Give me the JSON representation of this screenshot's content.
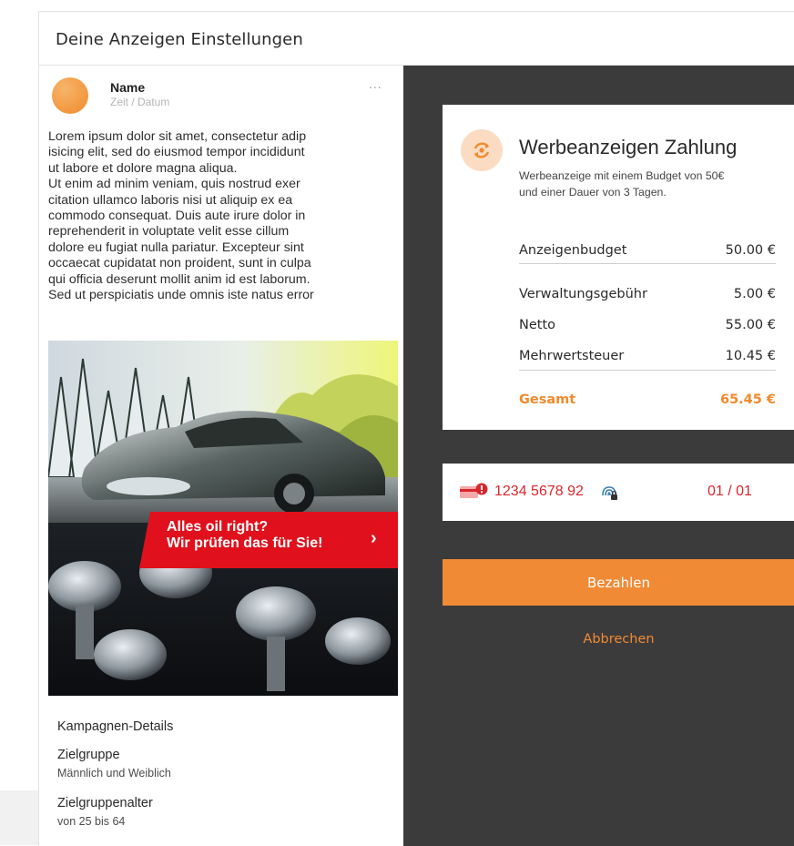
{
  "window": {
    "title": "Deine Anzeigen Einstellungen"
  },
  "post": {
    "name": "Name",
    "time": "Zeit / Datum",
    "more": "...",
    "body_lines": [
      "Lorem ipsum dolor sit amet, consectetur adip",
      "isicing elit, sed do eiusmod tempor incididunt",
      "ut labore et dolore magna aliqua.",
      "Ut enim ad minim veniam, quis nostrud exer",
      "citation ullamco laboris nisi ut aliquip ex ea",
      "commodo consequat. Duis aute irure dolor in",
      "reprehenderit in voluptate velit esse cillum",
      "dolore eu fugiat nulla pariatur. Excepteur sint",
      "occaecat cupidatat non proident, sunt in culpa",
      "qui officia deserunt mollit anim id est laborum.",
      "Sed ut perspiciatis unde omnis iste natus error"
    ],
    "ad_banner_line1": "Alles oil right?",
    "ad_banner_line2": "Wir prüfen das für Sie!",
    "ad_banner_arrow": "›"
  },
  "campaign": {
    "heading": "Kampagnen-Details",
    "target_group_label": "Zielgruppe",
    "target_group_value": "Männlich und Weiblich",
    "age_label": "Zielgruppenalter",
    "age_value": "von 25 bis 64"
  },
  "payment": {
    "title": "Werbeanzeigen Zahlung",
    "subtitle_line1": "Werbeanzeige mit einem Budget von 50€",
    "subtitle_line2": "und einer Dauer von 3 Tagen.",
    "rows": [
      {
        "label": "Anzeigenbudget",
        "value": "50.00 €"
      },
      {
        "label": "Verwaltungsgebühr",
        "value": "5.00 €"
      },
      {
        "label": "Netto",
        "value": "55.00 €"
      },
      {
        "label": "Mehrwertsteuer",
        "value": "10.45 €"
      }
    ],
    "total": {
      "label": "Gesamt",
      "value": "65.45 €"
    }
  },
  "card": {
    "number": "1234 5678 92",
    "count": "01 / 01"
  },
  "actions": {
    "pay_label": "Bezahlen",
    "cancel_label": "Abbrechen"
  },
  "colors": {
    "accent": "#f08a35",
    "error": "#d9262d",
    "panel_dark": "#3b3b3b",
    "banner_red": "#e0111c"
  },
  "icons": [
    "exchange-icon",
    "card-error-icon",
    "fingerprint-lock-icon",
    "more-icon",
    "chevron-right-icon"
  ]
}
